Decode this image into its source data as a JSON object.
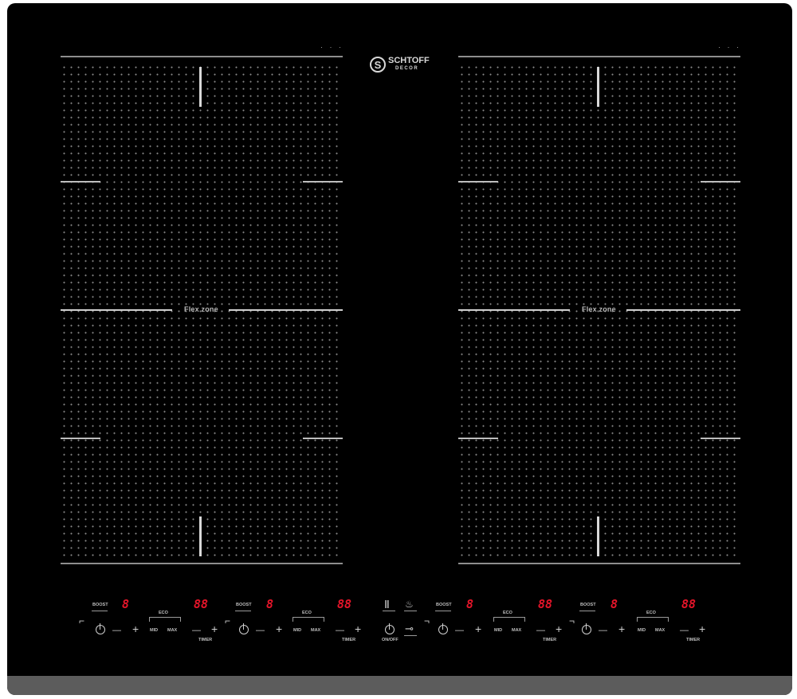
{
  "brand": {
    "name": "SCHTOFF",
    "sub": "DECOR",
    "mark": "S"
  },
  "zones": {
    "left_label": "Flex zone",
    "right_label": "Flex zone",
    "indicator": "· · ·"
  },
  "controls": {
    "boost": "BOOST",
    "mid": "MID",
    "max": "MAX",
    "timer": "TIMER",
    "on_off": "ON/OFF",
    "minus": "—",
    "plus": "+",
    "eco_label": "ECO",
    "level_digit": "8",
    "timer_digits": "88",
    "lock_symbol": "⊸",
    "keep_warm_symbol": "♨",
    "pause_symbol": "Ⅱ"
  },
  "colors": {
    "glass": "#000000",
    "display": "#e8152a",
    "frame": "#5c5c5c"
  }
}
